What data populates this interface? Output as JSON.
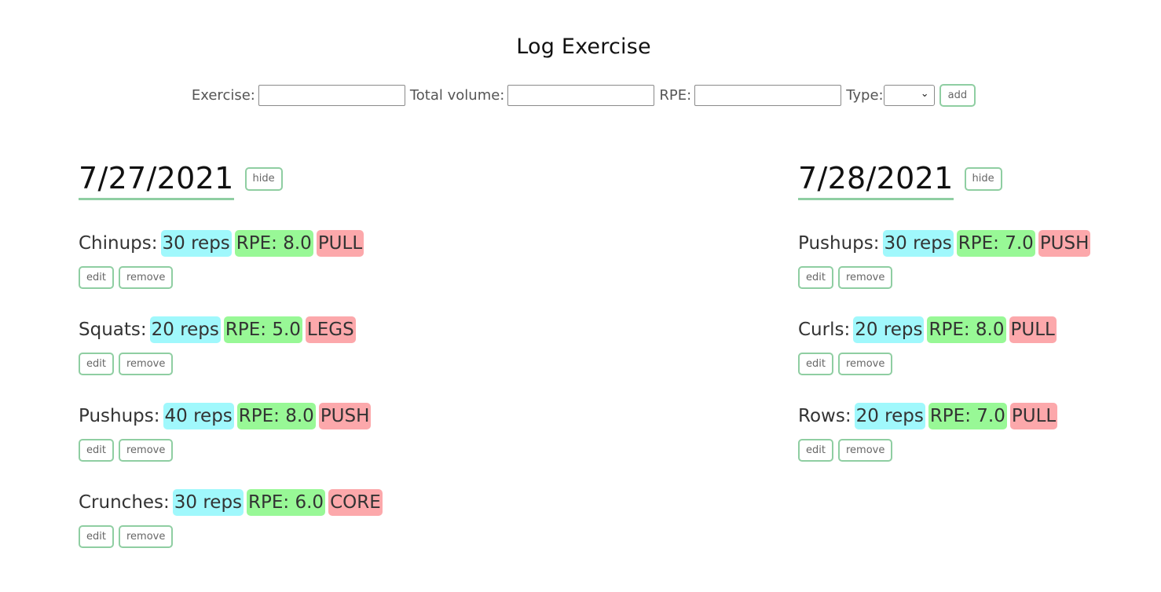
{
  "title": "Log Exercise",
  "form": {
    "exercise_label": "Exercise:",
    "volume_label": "Total volume:",
    "rpe_label": "RPE:",
    "type_label": "Type:",
    "exercise_value": "",
    "volume_value": "",
    "rpe_value": "",
    "type_value": "",
    "add_label": "add"
  },
  "days": [
    {
      "date": "7/27/2021",
      "hide_label": "hide",
      "entries": [
        {
          "name": "Chinups:",
          "volume": "30 reps",
          "rpe": "RPE: 8.0",
          "type": "PULL",
          "edit": "edit",
          "remove": "remove"
        },
        {
          "name": "Squats:",
          "volume": "20 reps",
          "rpe": "RPE: 5.0",
          "type": "LEGS",
          "edit": "edit",
          "remove": "remove"
        },
        {
          "name": "Pushups:",
          "volume": "40 reps",
          "rpe": "RPE: 8.0",
          "type": "PUSH",
          "edit": "edit",
          "remove": "remove"
        },
        {
          "name": "Crunches:",
          "volume": "30 reps",
          "rpe": "RPE: 6.0",
          "type": "CORE",
          "edit": "edit",
          "remove": "remove"
        }
      ]
    },
    {
      "date": "7/28/2021",
      "hide_label": "hide",
      "entries": [
        {
          "name": "Pushups:",
          "volume": "30 reps",
          "rpe": "RPE: 7.0",
          "type": "PUSH",
          "edit": "edit",
          "remove": "remove"
        },
        {
          "name": "Curls:",
          "volume": "20 reps",
          "rpe": "RPE: 8.0",
          "type": "PULL",
          "edit": "edit",
          "remove": "remove"
        },
        {
          "name": "Rows:",
          "volume": "20 reps",
          "rpe": "RPE: 7.0",
          "type": "PULL",
          "edit": "edit",
          "remove": "remove"
        }
      ]
    }
  ],
  "colors": {
    "accent_border": "#8fcea2",
    "volume_tag": "#a0f8fc",
    "rpe_tag": "#98f896",
    "type_tag": "#fca8ab"
  }
}
